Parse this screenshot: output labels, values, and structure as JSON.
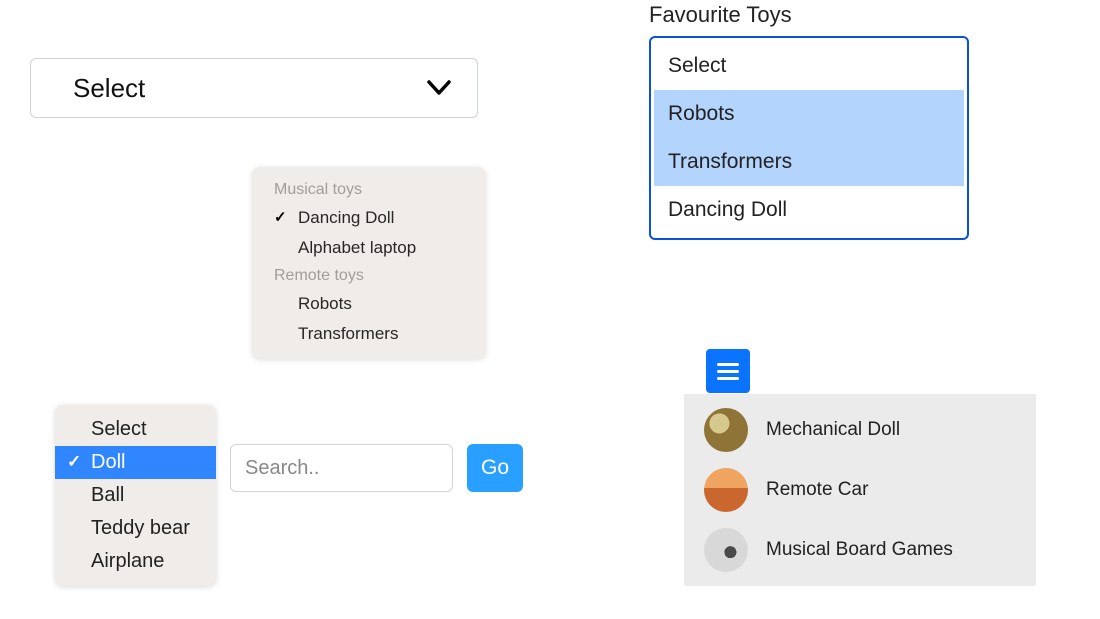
{
  "simple_select": {
    "value": "Select"
  },
  "grouped_select": {
    "groups": [
      {
        "label": "Musical toys",
        "items": [
          {
            "label": "Dancing Doll",
            "checked": true
          },
          {
            "label": "Alphabet laptop",
            "checked": false
          }
        ]
      },
      {
        "label": "Remote toys",
        "items": [
          {
            "label": "Robots",
            "checked": false
          },
          {
            "label": "Transformers",
            "checked": false
          }
        ]
      }
    ]
  },
  "single_select": {
    "items": [
      {
        "label": "Select",
        "selected": false
      },
      {
        "label": "Doll",
        "selected": true
      },
      {
        "label": "Ball",
        "selected": false
      },
      {
        "label": "Teddy bear",
        "selected": false
      },
      {
        "label": "Airplane",
        "selected": false
      }
    ]
  },
  "search": {
    "value": "",
    "placeholder": "Search..",
    "button": "Go"
  },
  "favourites": {
    "title": "Favourite Toys",
    "items": [
      {
        "label": "Select",
        "selected": false
      },
      {
        "label": "Robots",
        "selected": true
      },
      {
        "label": "Transformers",
        "selected": true
      },
      {
        "label": "Dancing Doll",
        "selected": false
      }
    ]
  },
  "hamburger": {
    "items": [
      {
        "label": "Mechanical Doll",
        "icon": "gears-icon",
        "color1": "#8e7436",
        "color2": "#d6c98d"
      },
      {
        "label": "Remote Car",
        "icon": "car-icon",
        "color1": "#c9672f",
        "color2": "#efa560"
      },
      {
        "label": "Musical Board Games",
        "icon": "pieces-icon",
        "color1": "#d8d8d8",
        "color2": "#4a4a4a"
      }
    ]
  }
}
